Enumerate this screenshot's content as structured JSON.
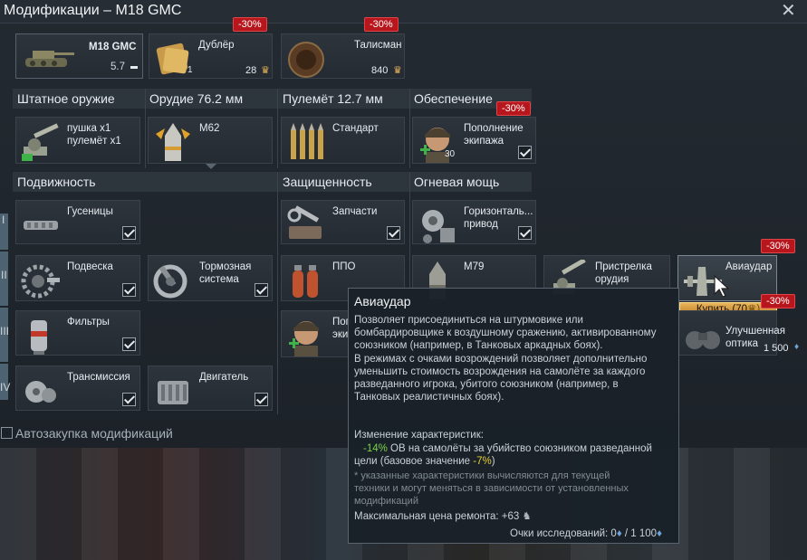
{
  "window": {
    "title": "Модификации – M18 GMC",
    "close": "✕"
  },
  "vehicle": {
    "name": "M18 GMC",
    "br": "5.7"
  },
  "crew": {
    "label": "Дублёр",
    "count": "1",
    "price": "28",
    "discount": "-30%"
  },
  "talisman": {
    "label": "Талисман",
    "price": "840",
    "discount": "-30%"
  },
  "sections": {
    "weapons": "Штатное оружие",
    "gun": "Орудие 76.2 мм",
    "mg": "Пулемёт 12.7 мм",
    "support": "Обеспечение",
    "mobility": "Подвижность",
    "protection": "Защищенность",
    "firepower": "Огневая мощь"
  },
  "mods": {
    "gunmg": "пушка x1\nпулемёт x1",
    "m62": "М62",
    "std": "Стандарт",
    "crewrep": "Пополнение экипажа",
    "crewrep_disc": "-30%",
    "crewrep_count": "30",
    "tracks": "Гусеницы",
    "parts": "Запчасти",
    "hdrive": "Горизонталь... привод",
    "susp": "Подвеска",
    "brakes": "Тормозная система",
    "ppo": "ППО",
    "m79": "М79",
    "zero": "Пристрелка орудия",
    "air": "Авиаудар",
    "air_disc": "-30%",
    "filters": "Фильтры",
    "crew2": "Поп… эки…",
    "optics": "Улучшенная оптика",
    "optics_disc": "-30%",
    "optics_price": "1 500",
    "trans": "Трансмиссия",
    "engine": "Двигатель"
  },
  "tiers": [
    "I",
    "II",
    "III",
    "IV"
  ],
  "buy": "Купить (70",
  "autobuy": "Автозакупка модификаций",
  "tooltip": {
    "title": "Авиаудар",
    "d1": "Позволяет присоединиться на штурмовике или",
    "d2": "бомбардировщике к воздушному сражению, активированному",
    "d3": "союзником (например, в Танковых аркадных боях).",
    "d4": "В режимах с очками возрождений позволяет дополнительно",
    "d5": "уменьшить стоимость возрождения на самолёте за каждого",
    "d6": "разведанного игрока, убитого союзником (например, в",
    "d7": "Танковых реалистичных боях).",
    "ch": "Изменение характеристик:",
    "v1": "-14%",
    "v1t": " ОВ на самолёты за убийство союзником разведанной",
    "v2t": "цели (базовое значение ",
    "v2": "-7%",
    "v2e": ")",
    "n1": "* указанные характеристики вычисляются для текущей",
    "n2": "техники и могут меняться в зависимости от установленных",
    "n3": "модификаций",
    "rep": "Максимальная цена ремонта: +63",
    "rp": "Очки исследований: 0",
    "rp2": " / 1 100"
  },
  "colors": {
    "discount": "#b7161c",
    "green": "#7bd34b",
    "yellow": "#e5cf3c",
    "gold": "#e8b45a"
  }
}
